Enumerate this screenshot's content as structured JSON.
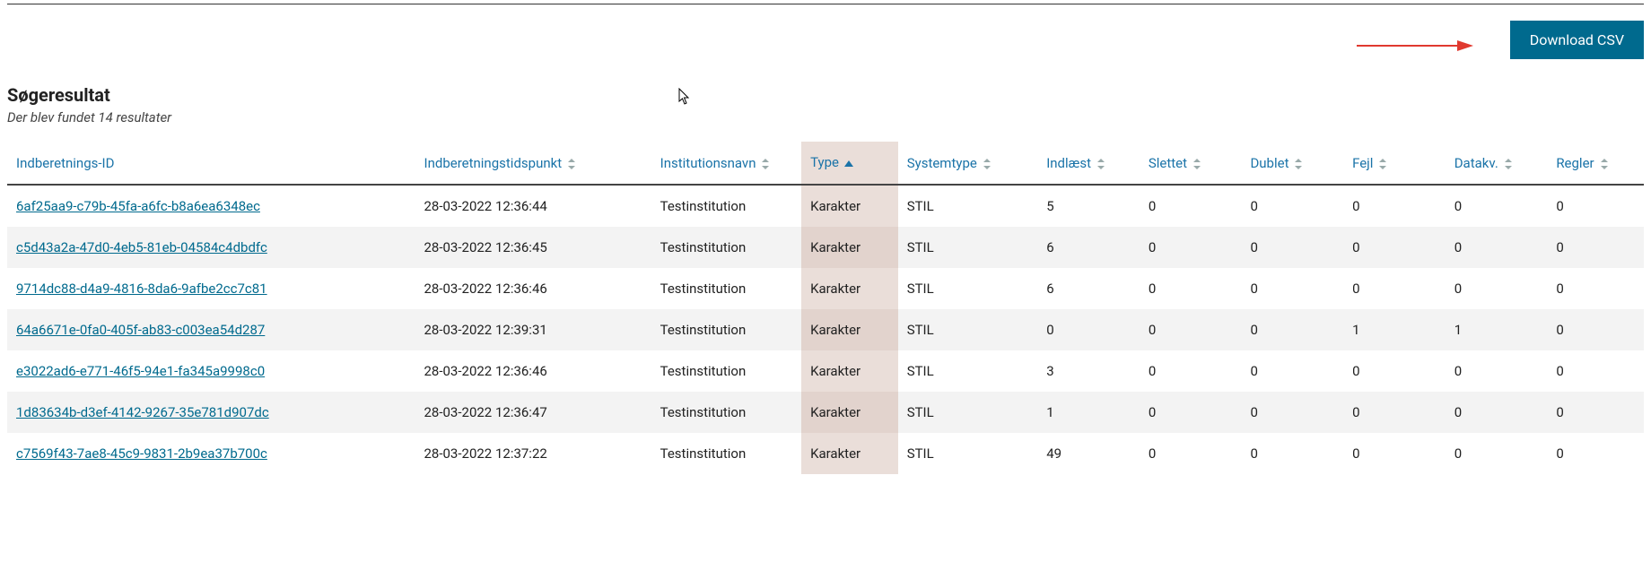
{
  "toolbar": {
    "download_label": "Download CSV"
  },
  "results": {
    "heading": "Søgeresultat",
    "subtext": "Der blev fundet 14 resultater"
  },
  "columns": {
    "id": "Indberetnings-ID",
    "timestamp": "Indberetningstidspunkt",
    "institution": "Institutionsnavn",
    "type": "Type",
    "systemtype": "Systemtype",
    "indlaest": "Indlæst",
    "slettet": "Slettet",
    "dublet": "Dublet",
    "fejl": "Fejl",
    "datakv": "Datakv.",
    "regler": "Regler"
  },
  "sort": {
    "column": "type",
    "direction": "asc"
  },
  "rows": [
    {
      "id": "6af25aa9-c79b-45fa-a6fc-b8a6ea6348ec",
      "timestamp": "28-03-2022 12:36:44",
      "institution": "Testinstitution",
      "type": "Karakter",
      "systemtype": "STIL",
      "indlaest": "5",
      "slettet": "0",
      "dublet": "0",
      "fejl": "0",
      "datakv": "0",
      "regler": "0"
    },
    {
      "id": "c5d43a2a-47d0-4eb5-81eb-04584c4dbdfc",
      "timestamp": "28-03-2022 12:36:45",
      "institution": "Testinstitution",
      "type": "Karakter",
      "systemtype": "STIL",
      "indlaest": "6",
      "slettet": "0",
      "dublet": "0",
      "fejl": "0",
      "datakv": "0",
      "regler": "0"
    },
    {
      "id": "9714dc88-d4a9-4816-8da6-9afbe2cc7c81",
      "timestamp": "28-03-2022 12:36:46",
      "institution": "Testinstitution",
      "type": "Karakter",
      "systemtype": "STIL",
      "indlaest": "6",
      "slettet": "0",
      "dublet": "0",
      "fejl": "0",
      "datakv": "0",
      "regler": "0"
    },
    {
      "id": "64a6671e-0fa0-405f-ab83-c003ea54d287",
      "timestamp": "28-03-2022 12:39:31",
      "institution": "Testinstitution",
      "type": "Karakter",
      "systemtype": "STIL",
      "indlaest": "0",
      "slettet": "0",
      "dublet": "0",
      "fejl": "1",
      "datakv": "1",
      "regler": "0"
    },
    {
      "id": "e3022ad6-e771-46f5-94e1-fa345a9998c0",
      "timestamp": "28-03-2022 12:36:46",
      "institution": "Testinstitution",
      "type": "Karakter",
      "systemtype": "STIL",
      "indlaest": "3",
      "slettet": "0",
      "dublet": "0",
      "fejl": "0",
      "datakv": "0",
      "regler": "0"
    },
    {
      "id": "1d83634b-d3ef-4142-9267-35e781d907dc",
      "timestamp": "28-03-2022 12:36:47",
      "institution": "Testinstitution",
      "type": "Karakter",
      "systemtype": "STIL",
      "indlaest": "1",
      "slettet": "0",
      "dublet": "0",
      "fejl": "0",
      "datakv": "0",
      "regler": "0"
    },
    {
      "id": "c7569f43-7ae8-45c9-9831-2b9ea37b700c",
      "timestamp": "28-03-2022 12:37:22",
      "institution": "Testinstitution",
      "type": "Karakter",
      "systemtype": "STIL",
      "indlaest": "49",
      "slettet": "0",
      "dublet": "0",
      "fejl": "0",
      "datakv": "0",
      "regler": "0"
    }
  ]
}
